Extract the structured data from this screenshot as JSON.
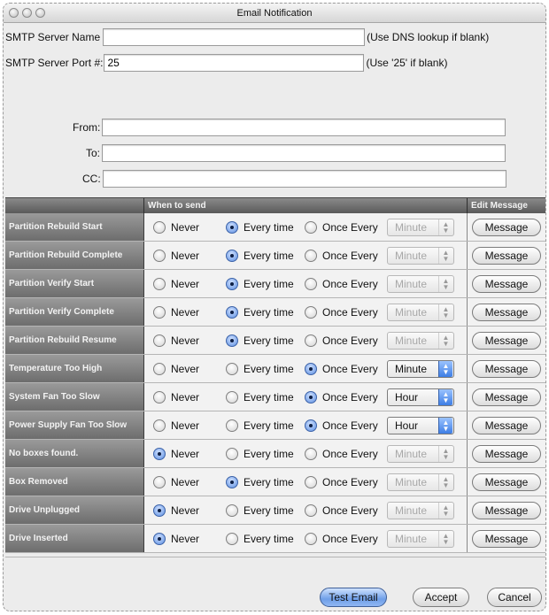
{
  "window": {
    "title": "Email Notification"
  },
  "smtp": {
    "server_label": "SMTP Server Name",
    "server_value": "",
    "server_hint": "(Use DNS lookup if blank)",
    "port_label": "SMTP Server Port #:",
    "port_value": "25",
    "port_hint": "(Use '25' if blank)"
  },
  "addresses": {
    "from_label": "From:",
    "from_value": "",
    "to_label": "To:",
    "to_value": "",
    "cc_label": "CC:",
    "cc_value": ""
  },
  "table": {
    "header_name": "",
    "header_when": "When to send",
    "header_edit": "Edit Message",
    "options": {
      "never": "Never",
      "every": "Every time",
      "once": "Once Every"
    },
    "message_label": "Message",
    "rows": [
      {
        "name": "Partition Rebuild Start",
        "selected": "every",
        "interval": "Minute",
        "interval_enabled": false
      },
      {
        "name": "Partition Rebuild Complete",
        "selected": "every",
        "interval": "Minute",
        "interval_enabled": false
      },
      {
        "name": "Partition Verify Start",
        "selected": "every",
        "interval": "Minute",
        "interval_enabled": false
      },
      {
        "name": "Partition Verify Complete",
        "selected": "every",
        "interval": "Minute",
        "interval_enabled": false
      },
      {
        "name": "Partition Rebuild Resume",
        "selected": "every",
        "interval": "Minute",
        "interval_enabled": false
      },
      {
        "name": "Temperature Too High",
        "selected": "once",
        "interval": "Minute",
        "interval_enabled": true
      },
      {
        "name": "System Fan Too Slow",
        "selected": "once",
        "interval": "Hour",
        "interval_enabled": true
      },
      {
        "name": "Power Supply Fan Too Slow",
        "selected": "once",
        "interval": "Hour",
        "interval_enabled": true
      },
      {
        "name": "No boxes found.",
        "selected": "never",
        "interval": "Minute",
        "interval_enabled": false
      },
      {
        "name": "Box Removed",
        "selected": "every",
        "interval": "Minute",
        "interval_enabled": false
      },
      {
        "name": "Drive Unplugged",
        "selected": "never",
        "interval": "Minute",
        "interval_enabled": false
      },
      {
        "name": "Drive Inserted",
        "selected": "never",
        "interval": "Minute",
        "interval_enabled": false
      }
    ]
  },
  "buttons": {
    "test": "Test Email",
    "accept": "Accept",
    "cancel": "Cancel"
  }
}
